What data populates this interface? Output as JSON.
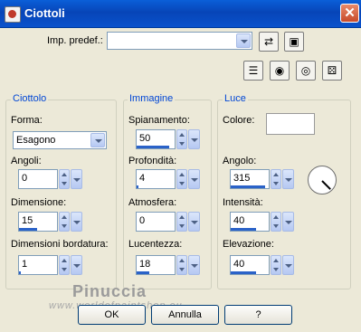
{
  "window": {
    "title": "Ciottoli",
    "close_symbol": "✕"
  },
  "preset": {
    "label": "Imp. predef.:",
    "value": ""
  },
  "groups": {
    "ciottolo": {
      "title": "Ciottolo",
      "forma_label": "Forma:",
      "forma_value": "Esagono",
      "angoli_label": "Angoli:",
      "angoli_value": "0",
      "dimensione_label": "Dimensione:",
      "dimensione_value": "15",
      "bordatura_label": "Dimensioni bordatura:",
      "bordatura_value": "1"
    },
    "immagine": {
      "title": "Immagine",
      "spianamento_label": "Spianamento:",
      "spianamento_value": "50",
      "profondita_label": "Profondità:",
      "profondita_value": "4",
      "atmosfera_label": "Atmosfera:",
      "atmosfera_value": "0",
      "lucentezza_label": "Lucentezza:",
      "lucentezza_value": "18"
    },
    "luce": {
      "title": "Luce",
      "colore_label": "Colore:",
      "colore_value": "#ffffff",
      "angolo_label": "Angolo:",
      "angolo_value": "315",
      "intensita_label": "Intensità:",
      "intensita_value": "40",
      "elevazione_label": "Elevazione:",
      "elevazione_value": "40"
    }
  },
  "buttons": {
    "ok": "OK",
    "annulla": "Annulla",
    "help": "?"
  },
  "watermark": {
    "text": "Pinuccia",
    "url": "www.worldofpaintshop.eu"
  },
  "colors": {
    "titlebar": "#0a52cc",
    "group_title": "#0046d5",
    "fill": "#2a62c8"
  }
}
